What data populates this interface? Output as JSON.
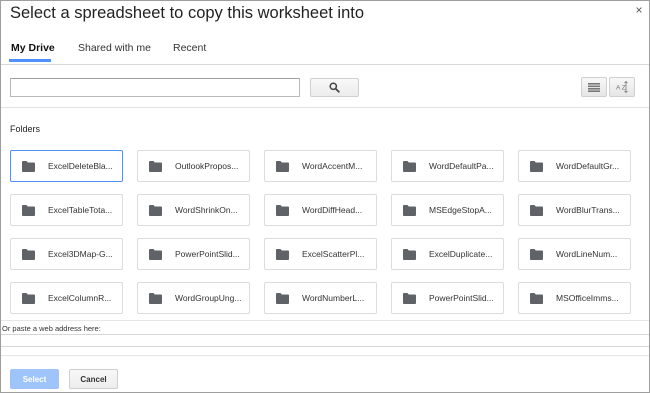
{
  "dialog": {
    "title": "Select a spreadsheet to copy this worksheet into",
    "close_glyph": "×"
  },
  "tabs": [
    {
      "label": "My Drive",
      "active": true
    },
    {
      "label": "Shared with me",
      "active": false
    },
    {
      "label": "Recent",
      "active": false
    }
  ],
  "search": {
    "value": "",
    "button_icon": "search-icon"
  },
  "view_buttons": {
    "list_icon": "list-view-icon",
    "sort_icon": "sort-az-icon",
    "sort_label": "A Z"
  },
  "folders_section": {
    "label": "Folders",
    "items": [
      {
        "name": "ExcelDeleteBla...",
        "selected": true
      },
      {
        "name": "OutlookPropos...",
        "selected": false
      },
      {
        "name": "WordAccentM...",
        "selected": false
      },
      {
        "name": "WordDefaultPa...",
        "selected": false
      },
      {
        "name": "WordDefaultGr...",
        "selected": false
      },
      {
        "name": "ExcelTableTota...",
        "selected": false
      },
      {
        "name": "WordShrinkOn...",
        "selected": false
      },
      {
        "name": "WordDiffHead...",
        "selected": false
      },
      {
        "name": "MSEdgeStopA...",
        "selected": false
      },
      {
        "name": "WordBlurTrans...",
        "selected": false
      },
      {
        "name": "Excel3DMap-G...",
        "selected": false
      },
      {
        "name": "PowerPointSlid...",
        "selected": false
      },
      {
        "name": "ExcelScatterPl...",
        "selected": false
      },
      {
        "name": "ExcelDuplicate...",
        "selected": false
      },
      {
        "name": "WordLineNum...",
        "selected": false
      },
      {
        "name": "ExcelColumnR...",
        "selected": false
      },
      {
        "name": "WordGroupUng...",
        "selected": false
      },
      {
        "name": "WordNumberL...",
        "selected": false
      },
      {
        "name": "PowerPointSlid...",
        "selected": false
      },
      {
        "name": "MSOfficeImms...",
        "selected": false
      }
    ]
  },
  "paste": {
    "label": "Or paste a web address here:",
    "value": ""
  },
  "footer": {
    "select_label": "Select",
    "cancel_label": "Cancel"
  },
  "colors": {
    "accent": "#4d90fe",
    "select_disabled": "#9fc4fa",
    "folder_icon": "#5f6368"
  }
}
